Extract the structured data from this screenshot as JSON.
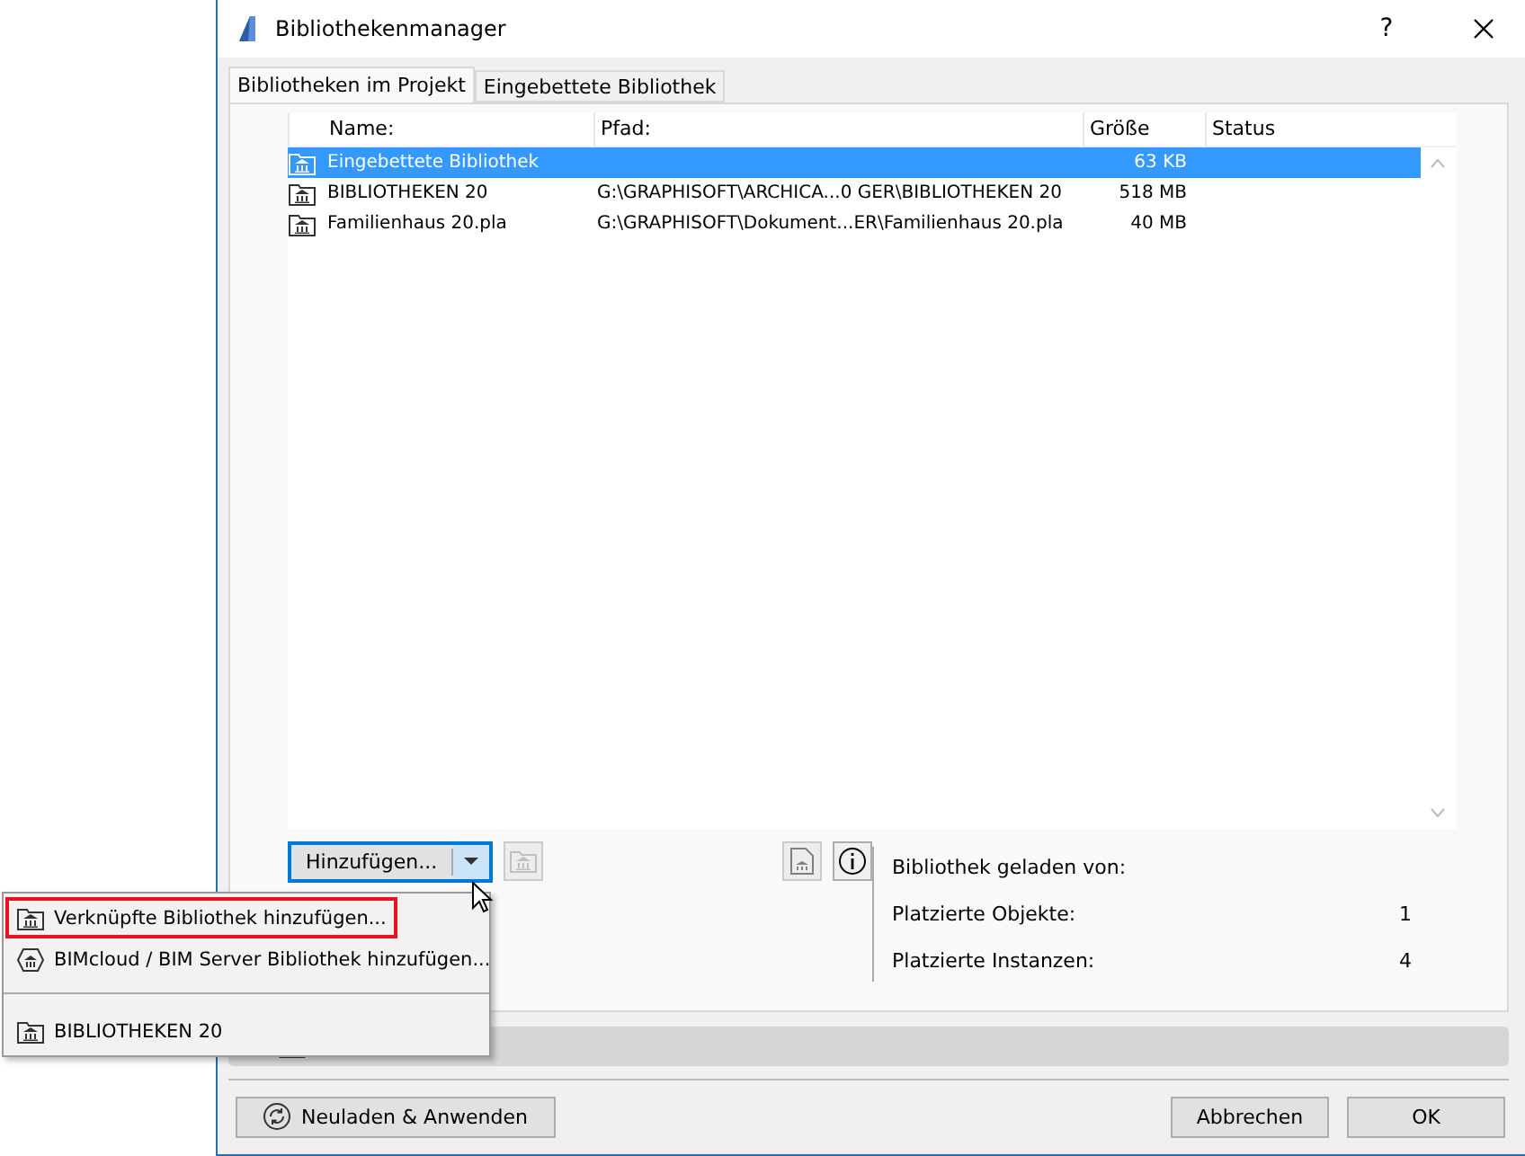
{
  "window": {
    "title": "Bibliothekenmanager",
    "help": "?"
  },
  "tabs": [
    {
      "label": "Bibliotheken im Projekt",
      "selected": true
    },
    {
      "label": "Eingebettete Bibliothek",
      "selected": false
    }
  ],
  "table": {
    "columns": [
      "Name:",
      "Pfad:",
      "Größe",
      "Status"
    ],
    "rows": [
      {
        "name": "Eingebettete Bibliothek",
        "path": "",
        "size": "63 KB",
        "status": "",
        "selected": true
      },
      {
        "name": "BIBLIOTHEKEN 20",
        "path": "G:\\GRAPHISOFT\\ARCHICA...0 GER\\BIBLIOTHEKEN 20",
        "size": "518 MB",
        "status": "",
        "selected": false
      },
      {
        "name": "Familienhaus 20.pla",
        "path": "G:\\GRAPHISOFT\\Dokument...ER\\Familienhaus 20.pla",
        "size": "40 MB",
        "status": "",
        "selected": false
      }
    ]
  },
  "add_button": {
    "label": "Hinzufügen..."
  },
  "info": [
    {
      "label": "Bibliothek geladen von:"
    },
    {
      "label": "Platzierte Objekte:",
      "value": "1"
    },
    {
      "label": "Platzierte Instanzen:",
      "value": "4"
    }
  ],
  "menu": {
    "items": [
      {
        "kind": "item",
        "label": "Verknüpfte Bibliothek hinzufügen...",
        "highlighted": true
      },
      {
        "kind": "item",
        "label": "BIMcloud / BIM Server Bibliothek hinzufügen...",
        "highlighted": false
      },
      {
        "kind": "separator"
      },
      {
        "kind": "item",
        "label": "BIBLIOTHEKEN 20",
        "highlighted": false
      }
    ]
  },
  "footer": {
    "reload": "Neuladen & Anwenden",
    "cancel": "Abbrechen",
    "ok": "OK"
  }
}
